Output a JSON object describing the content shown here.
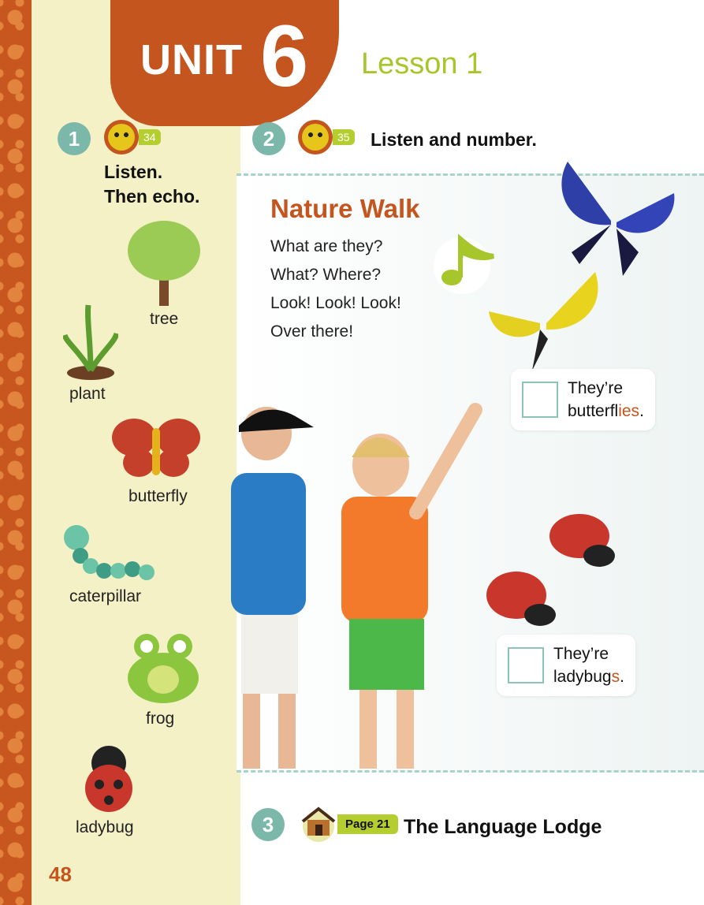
{
  "header": {
    "unit_word": "UNIT",
    "unit_number": "6",
    "lesson": "Lesson 1"
  },
  "activity1": {
    "number": "1",
    "track": "34",
    "instruction_line1": "Listen.",
    "instruction_line2": "Then echo.",
    "vocabulary": [
      "tree",
      "plant",
      "butterfly",
      "caterpillar",
      "frog",
      "ladybug"
    ]
  },
  "activity2": {
    "number": "2",
    "track": "35",
    "instruction": "Listen and number.",
    "song_title": "Nature Walk",
    "song_lines": [
      "What are they?",
      "What? Where?",
      "Look! Look! Look!",
      "Over there!"
    ],
    "answer1": {
      "line1": "They’re",
      "line2_base": "butterfl",
      "line2_suffix": "ies",
      "line2_end": "."
    },
    "answer2": {
      "line1": "They’re",
      "line2_base": "ladybug",
      "line2_suffix": "s",
      "line2_end": "."
    }
  },
  "activity3": {
    "number": "3",
    "page_badge": "Page 21",
    "title": "The Language Lodge"
  },
  "page_number": "48",
  "colors": {
    "accent_orange": "#c4551e",
    "teal": "#7bb8a9",
    "lime": "#a7c62c"
  }
}
